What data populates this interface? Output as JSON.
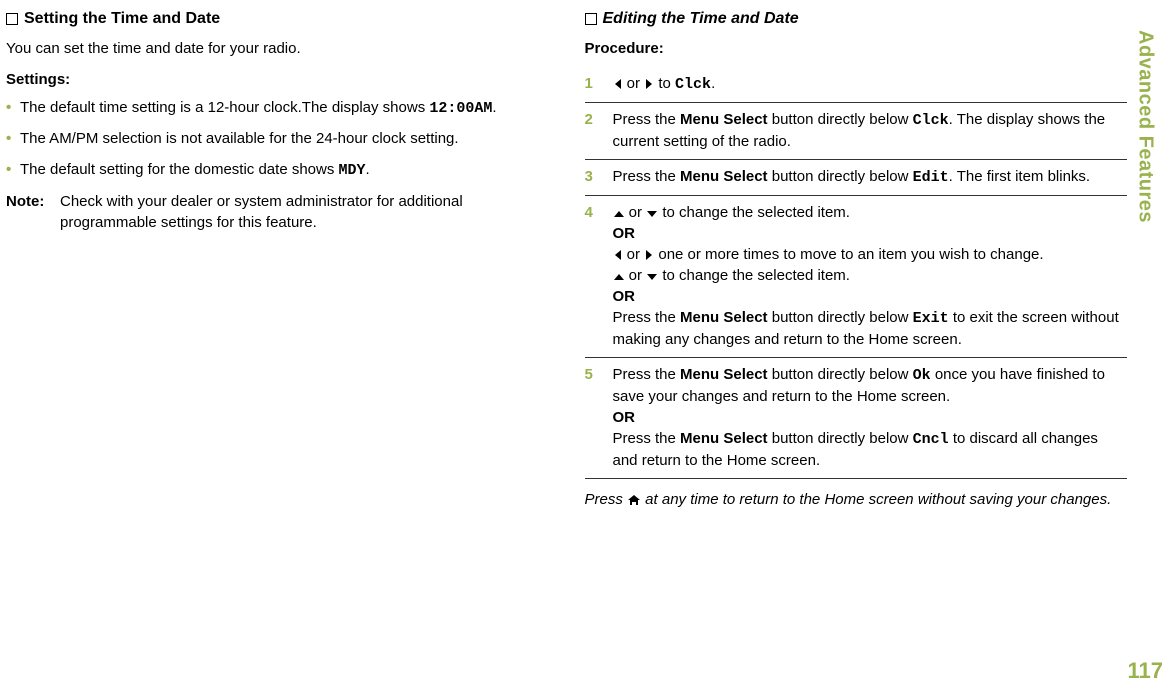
{
  "sidebar": {
    "label": "Advanced Features",
    "page_number": "117"
  },
  "left": {
    "heading": "Setting the Time and Date",
    "lead": "You can set the time and date for your radio.",
    "settings_label": "Settings:",
    "bullets": {
      "b1_a": "The default time setting is a 12-hour clock.The display shows ",
      "b1_mono": "12:00AM",
      "b1_b": ".",
      "b2": "The AM/PM selection is not available for the 24-hour clock setting.",
      "b3_a": "The default setting for the domestic date shows ",
      "b3_mono": "MDY",
      "b3_b": "."
    },
    "note_label": "Note:",
    "note_text": "Check with your dealer or system administrator for additional programmable settings for this feature."
  },
  "right": {
    "heading": "Editing the Time and Date",
    "proc_label": "Procedure:",
    "steps": {
      "s1": {
        "num": "1",
        "a": " or ",
        "b": " to ",
        "mono": "Clck",
        "c": "."
      },
      "s2": {
        "num": "2",
        "a": "Press the ",
        "bold": "Menu Select",
        "b": " button directly below ",
        "mono": "Clck",
        "c": ". The display shows the current setting of the radio."
      },
      "s3": {
        "num": "3",
        "a": "Press the ",
        "bold": "Menu Select",
        "b": " button directly below ",
        "mono": "Edit",
        "c": ". The first item blinks."
      },
      "s4": {
        "num": "4",
        "line1_mid": " or ",
        "line1_end": " to change the selected item.",
        "or": "OR",
        "line2_mid": " or ",
        "line2_end": " one or more times to move to an item you wish to change.",
        "line3_mid": " or ",
        "line3_end": " to change the selected item.",
        "or2": "OR",
        "line4_a": "Press the ",
        "line4_bold": "Menu Select",
        "line4_b": " button directly below ",
        "line4_mono": "Exit",
        "line4_c": " to exit the screen without making any changes and return to the Home screen."
      },
      "s5": {
        "num": "5",
        "a": "Press the ",
        "bold1": "Menu Select",
        "b": " button directly below ",
        "mono1": "Ok",
        "c": " once you have finished to save your changes and return to the Home screen.",
        "or": "OR",
        "d": "Press the ",
        "bold2": "Menu Select",
        "e": " button directly below ",
        "mono2": "Cncl",
        "f": " to discard all changes and return to the Home screen."
      }
    },
    "tail_a": "Press ",
    "tail_b": " at any time to return to the Home screen without saving your changes."
  }
}
